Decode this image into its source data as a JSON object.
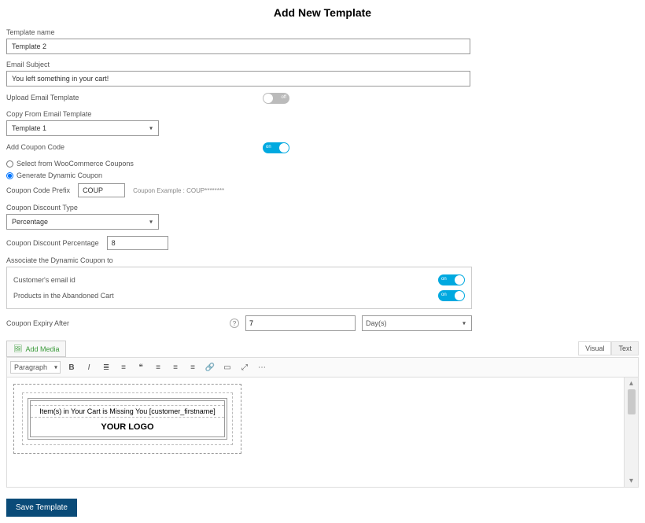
{
  "pageTitle": "Add New Template",
  "fields": {
    "templateName": {
      "label": "Template name",
      "value": "Template 2"
    },
    "emailSubject": {
      "label": "Email Subject",
      "value": "You left something in your cart!"
    },
    "uploadEmailTemplate": {
      "label": "Upload Email Template",
      "toggle": "off"
    },
    "copyFromEmailTemplate": {
      "label": "Copy From Email Template",
      "value": "Template 1"
    },
    "addCouponCode": {
      "label": "Add Coupon Code",
      "toggle": "on"
    },
    "couponSource": {
      "option1": "Select from WooCommerce Coupons",
      "option2": "Generate Dynamic Coupon",
      "selected": "option2"
    },
    "couponCodePrefix": {
      "label": "Coupon Code Prefix",
      "value": "COUP",
      "example": "Coupon Example : COUP********"
    },
    "couponDiscountType": {
      "label": "Coupon Discount Type",
      "value": "Percentage"
    },
    "couponDiscountPercentage": {
      "label": "Coupon Discount Percentage",
      "value": "8"
    },
    "associateDynamicCouponTo": {
      "label": "Associate the Dynamic Coupon to",
      "customerEmailId": {
        "label": "Customer's email id",
        "toggle": "on"
      },
      "productsInCart": {
        "label": "Products in the Abandoned Cart",
        "toggle": "on"
      }
    },
    "couponExpiryAfter": {
      "label": "Coupon Expiry After",
      "value": "7",
      "unit": "Day(s)"
    }
  },
  "editor": {
    "addMediaLabel": "Add Media",
    "tabs": {
      "visual": "Visual",
      "text": "Text"
    },
    "paragraphSelect": "Paragraph",
    "templatePreview": {
      "line1": "Item(s) in Your Cart is Missing You [customer_firstname]",
      "line2": "YOUR LOGO"
    }
  },
  "toggleLabels": {
    "on": "on",
    "off": "off"
  },
  "buttons": {
    "save": "Save Template"
  }
}
